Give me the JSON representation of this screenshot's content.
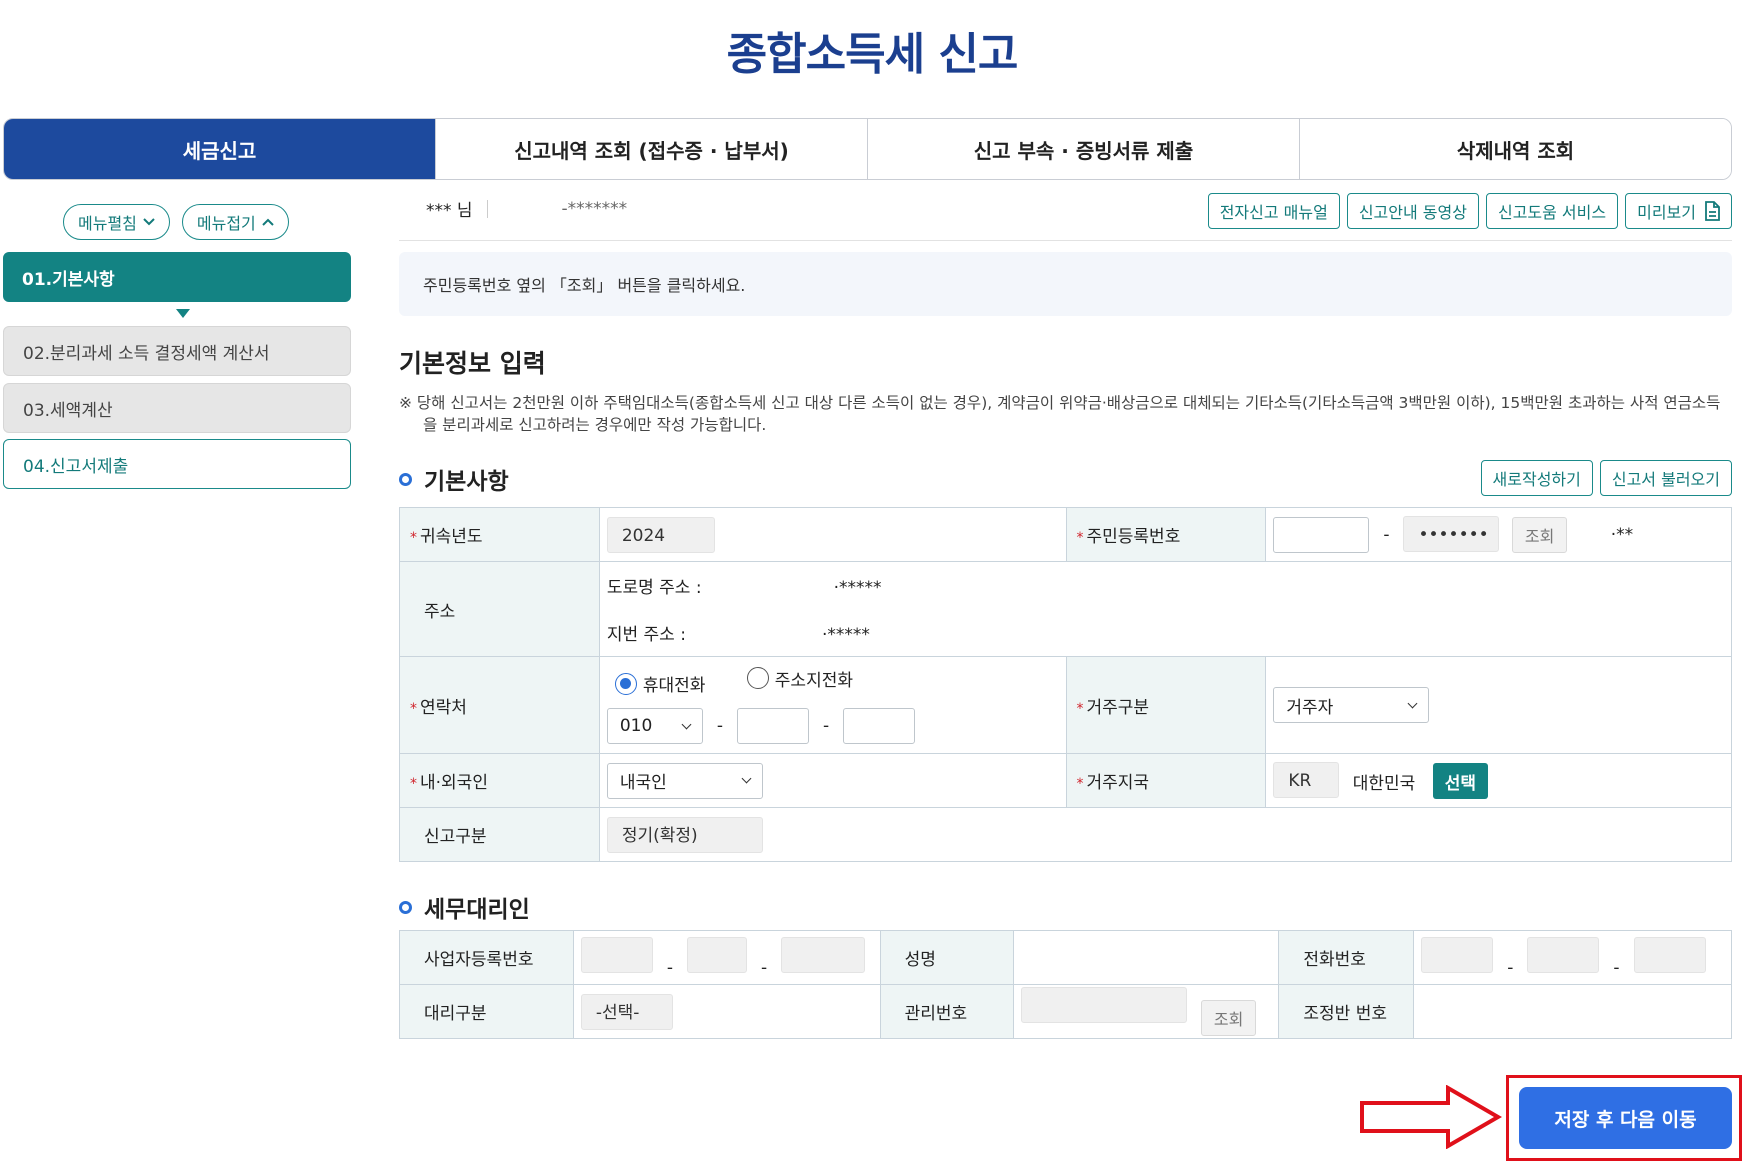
{
  "page_title": "종합소득세 신고",
  "tabs": [
    {
      "label": "세금신고"
    },
    {
      "label": "신고내역 조회 (접수증 · 납부서)"
    },
    {
      "label": "신고 부속 · 증빙서류 제출"
    },
    {
      "label": "삭제내역 조회"
    }
  ],
  "sidebar": {
    "expand_label": "메뉴펼침",
    "collapse_label": "메뉴접기",
    "steps": [
      {
        "label": "01.기본사항"
      },
      {
        "label": "02.분리과세 소득 결정세액 계산서"
      },
      {
        "label": "03.세액계산"
      },
      {
        "label": "04.신고서제출"
      }
    ]
  },
  "user": {
    "name": "*** 님",
    "id": "-*******"
  },
  "help_buttons": [
    {
      "label": "전자신고 매뉴얼"
    },
    {
      "label": "신고안내 동영상"
    },
    {
      "label": "신고도움 서비스"
    },
    {
      "label": "미리보기"
    }
  ],
  "notice": "주민등록번호 옆의 「조회」 버튼을 클릭하세요.",
  "section": {
    "title": "기본정보 입력",
    "note": "※ 당해 신고서는 2천만원 이하 주택임대소득(종합소득세 신고 대상 다른 소득이 없는 경우), 계약금이 위약금·배상금으로 대체되는 기타소득(기타소득금액 3백만원 이하), 15백만원 초과하는 사적 연금소득을 분리과세로 신고하려는 경우에만 작성 가능합니다."
  },
  "basic": {
    "title": "기본사항",
    "new_button": "새로작성하기",
    "load_button": "신고서 불러오기",
    "year_label": "귀속년도",
    "year_value": "2024",
    "rrn_label": "주민등록번호",
    "rrn_back": "•••••••",
    "rrn_lookup": "조회",
    "rrn_name": "·**",
    "address_label": "주소",
    "road_label": "도로명 주소 :",
    "road_value": "·*****",
    "lot_label": "지번 주소 :",
    "lot_value": "·*****",
    "contact_label": "연락처",
    "radio_mobile": "휴대전화",
    "radio_home": "주소지전화",
    "phone_prefix": "010",
    "residence_label": "거주구분",
    "residence_value": "거주자",
    "nationality_label": "내·외국인",
    "nationality_value": "내국인",
    "country_label": "거주지국",
    "country_code": "KR",
    "country_name": "대한민국",
    "country_select": "선택",
    "filing_type_label": "신고구분",
    "filing_type_value": "정기(확정)"
  },
  "agent": {
    "title": "세무대리인",
    "biz_no_label": "사업자등록번호",
    "name_label": "성명",
    "phone_label": "전화번호",
    "agent_type_label": "대리구분",
    "agent_type_value": "-선택-",
    "mgmt_no_label": "관리번호",
    "mgmt_lookup": "조회",
    "adjust_no_label": "조정반 번호"
  },
  "next_button": "저장 후 다음 이동",
  "colors": {
    "brand": "#1d4a9e",
    "teal": "#138383",
    "primary_btn": "#2f6fe4",
    "highlight": "#e0101a"
  }
}
